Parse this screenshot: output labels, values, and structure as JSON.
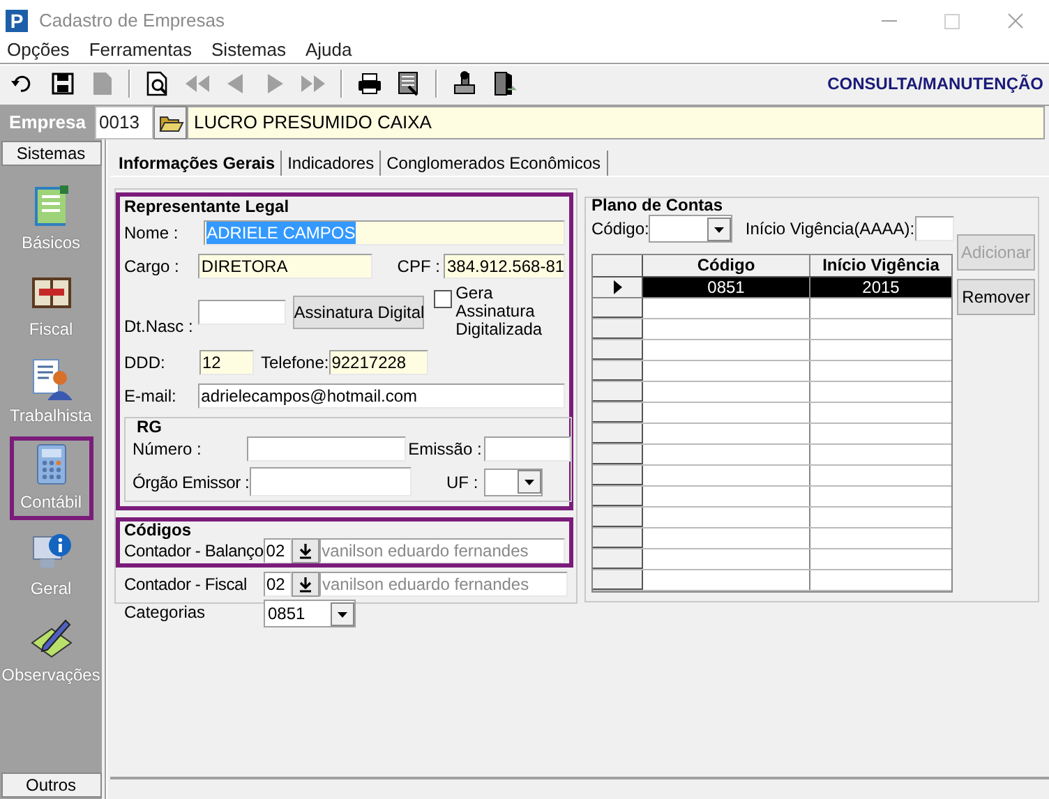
{
  "window": {
    "icon_letter": "P",
    "title": "Cadastro de Empresas"
  },
  "menu": [
    "Opções",
    "Ferramentas",
    "Sistemas",
    "Ajuda"
  ],
  "toolbar": {
    "groups": [
      [
        {
          "kind": "undo",
          "disabled": false
        },
        {
          "kind": "save",
          "disabled": false
        },
        {
          "kind": "document",
          "disabled": true
        }
      ],
      [
        {
          "kind": "preview",
          "disabled": false
        },
        {
          "kind": "first",
          "disabled": true
        },
        {
          "kind": "previous",
          "disabled": true
        },
        {
          "kind": "next",
          "disabled": true
        },
        {
          "kind": "last",
          "disabled": true
        }
      ],
      [
        {
          "kind": "print",
          "disabled": false
        },
        {
          "kind": "report",
          "disabled": false
        }
      ],
      [
        {
          "kind": "stamp",
          "disabled": false
        },
        {
          "kind": "exit",
          "disabled": false
        }
      ]
    ],
    "mode": "CONSULTA/MANUTENÇÃO"
  },
  "empresa": {
    "label": "Empresa",
    "code": "0013",
    "name": "LUCRO PRESUMIDO CAIXA"
  },
  "sidebar": {
    "header": "Sistemas",
    "items": [
      {
        "kind": "basicos",
        "label": "Básicos",
        "highlighted": false
      },
      {
        "kind": "fiscal",
        "label": "Fiscal",
        "highlighted": false
      },
      {
        "kind": "trabalhista",
        "label": "Trabalhista",
        "highlighted": false
      },
      {
        "kind": "contabil",
        "label": "Contábil",
        "highlighted": true
      },
      {
        "kind": "geral",
        "label": "Geral",
        "highlighted": false
      },
      {
        "kind": "observacoes",
        "label": "Observações",
        "highlighted": false
      }
    ],
    "footer": "Outros"
  },
  "tabs": [
    {
      "label": "Informações Gerais",
      "selected": true
    },
    {
      "label": "Indicadores",
      "selected": false
    },
    {
      "label": "Conglomerados Econômicos",
      "selected": false
    }
  ],
  "representante": {
    "title": "Representante Legal",
    "highlighted": true,
    "nome": {
      "label": "Nome :",
      "value": "ADRIELE CAMPOS",
      "required": true,
      "text_selected": true
    },
    "cargo": {
      "label": "Cargo :",
      "value": "DIRETORA",
      "required": true
    },
    "cpf": {
      "label": "CPF :",
      "value": "384.912.568-81",
      "required": true
    },
    "dt_nasc": {
      "label": "Dt.Nasc :",
      "required": false
    },
    "assinatura_button": "Assinatura Digital",
    "gera_assinatura": {
      "label": "Gera Assinatura Digitalizada",
      "checked": false
    },
    "ddd": {
      "label": "DDD:",
      "value": "12",
      "required": true
    },
    "telefone": {
      "label": "Telefone:",
      "value": "92217228",
      "required": true
    },
    "email": {
      "label": "E-mail:",
      "value": "adrielecampos@hotmail.com",
      "required": false
    },
    "rg": {
      "title": "RG",
      "numero": {
        "label": "Número :"
      },
      "emissao": {
        "label": "Emissão :"
      },
      "orgao_emissor": {
        "label": "Órgão Emissor :"
      },
      "uf": {
        "label": "UF :"
      }
    }
  },
  "codigos": {
    "title": "Códigos",
    "highlighted": true,
    "contador_balanco": {
      "label": "Contador - Balanço",
      "code": "02",
      "name": "vanilson eduardo fernandes"
    },
    "contador_fiscal": {
      "label": "Contador - Fiscal",
      "code": "02",
      "name": "vanilson eduardo fernandes"
    },
    "categorias": {
      "label": "Categorias",
      "value": "0851"
    }
  },
  "plano_de_contas": {
    "title": "Plano de Contas",
    "codigo_label": "Código:",
    "inicio_label": "Início Vigência(AAAA):",
    "buttons": [
      {
        "label": "Adicionar",
        "disabled": true
      },
      {
        "label": "Remover",
        "disabled": false
      }
    ],
    "columns": [
      "Código",
      "Início Vigência"
    ],
    "rows": [
      {
        "codigo": "0851",
        "inicio": "2015",
        "selected": true
      }
    ]
  }
}
